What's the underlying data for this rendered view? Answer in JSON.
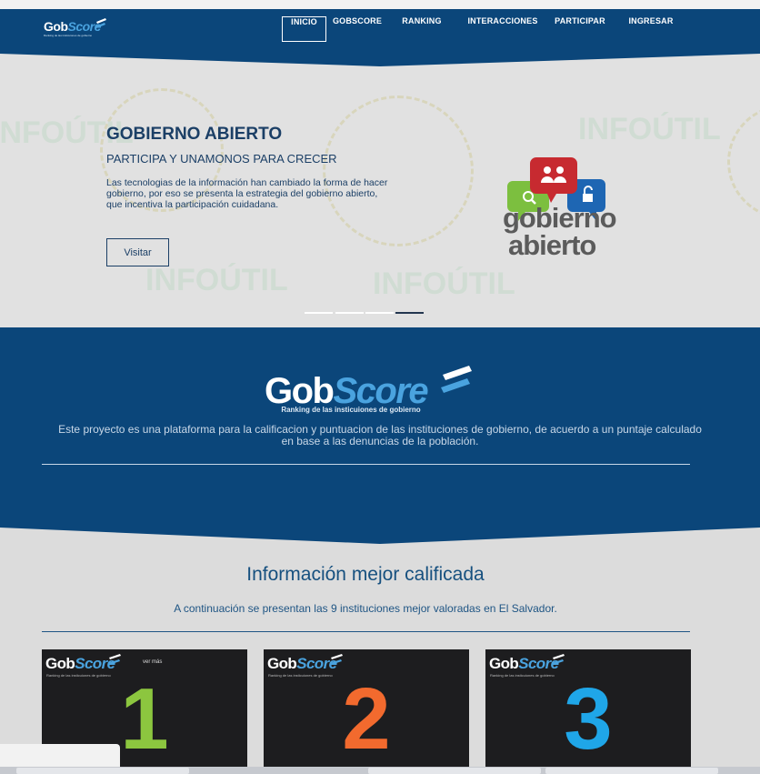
{
  "brand": {
    "name_part1": "Gob",
    "name_part2": "Score",
    "tagline": "Ranking de las insticuiones de gobierno"
  },
  "nav": {
    "items": [
      {
        "label": "INICIO",
        "active": true
      },
      {
        "label": "GOBSCORE",
        "active": false
      },
      {
        "label": "RANKING",
        "active": false
      },
      {
        "label": "INTERACCIONES",
        "active": false
      },
      {
        "label": "PARTICIPAR",
        "active": false
      },
      {
        "label": "INGRESAR",
        "active": false
      }
    ]
  },
  "hero": {
    "title": "GOBIERNO ABIERTO",
    "subtitle": "PARTICIPA Y UNAMONOS PARA CRECER",
    "description": "Las tecnologias de la información han cambiado la forma de hacer gobierno, por eso se presenta la estrategia del gobierno abierto, que incentiva la participación cuidadana.",
    "button_label": "Visitar",
    "graphic_line1": "gobierno",
    "graphic_line2": "abierto",
    "watermark_text": "INFOÚTIL",
    "slides_count": 4,
    "active_slide": 4
  },
  "about": {
    "description": "Este proyecto es una plataforma para la calificacion y puntuacion de las instituciones de gobierno, de acuerdo a un puntaje calculado en base a las denuncias de la población."
  },
  "info": {
    "title": "Información mejor calificada",
    "subtitle": "A continuación se presentan las 9 instituciones mejor valoradas en El Salvador.",
    "cards": [
      {
        "rank": "1",
        "color": "#8cc63f",
        "extra": "ver más"
      },
      {
        "rank": "2",
        "color": "#f26a2e",
        "extra": ""
      },
      {
        "rank": "3",
        "color": "#1fa6e8",
        "extra": ""
      }
    ]
  },
  "colors": {
    "nav_bg": "#0b467a",
    "accent": "#4aa3df",
    "hero_text": "#1b3f66"
  }
}
